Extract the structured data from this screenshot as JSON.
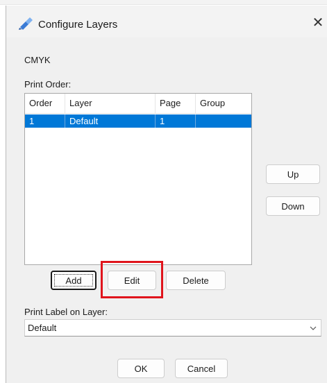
{
  "dialog": {
    "title": "Configure Layers",
    "close_symbol": "✕",
    "icon": "pencil-layers-icon"
  },
  "color_mode": "CMYK",
  "print_order": {
    "label": "Print Order:",
    "columns": [
      "Order",
      "Layer",
      "Page",
      "Group"
    ],
    "rows": [
      {
        "order": "1",
        "layer": "Default",
        "page": "1",
        "group": ""
      }
    ]
  },
  "buttons": {
    "up": "Up",
    "down": "Down",
    "add": "Add",
    "edit": "Edit",
    "delete": "Delete",
    "ok": "OK",
    "cancel": "Cancel"
  },
  "print_label": {
    "label": "Print Label on Layer:",
    "value": "Default"
  },
  "colors": {
    "selection": "#0078d7",
    "highlight_box": "#e0141c",
    "dialog_bg": "#f0f0f0"
  }
}
